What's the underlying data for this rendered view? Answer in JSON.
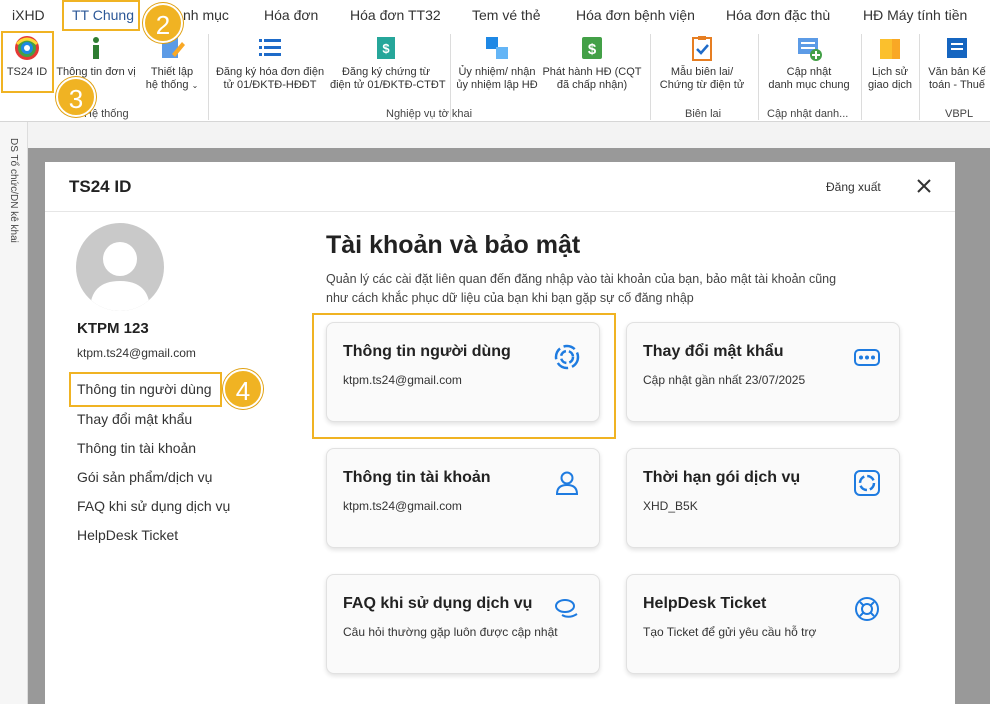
{
  "menu": {
    "tabs": [
      {
        "label": "iXHD"
      },
      {
        "label": "TT Chung"
      },
      {
        "label": "nh mục"
      },
      {
        "label": "Hóa đơn"
      },
      {
        "label": "Hóa đơn TT32"
      },
      {
        "label": "Tem vé thẻ"
      },
      {
        "label": "Hóa đơn bệnh viện"
      },
      {
        "label": "Hóa đơn đặc thù"
      },
      {
        "label": "HĐ Máy tính tiền"
      }
    ]
  },
  "ribbon": {
    "buttons": [
      {
        "label": "TS24 ID",
        "icon": "ts24-logo-icon"
      },
      {
        "label": "Thông tin đơn vị",
        "icon": "info-icon"
      },
      {
        "label": "Thiết lập\nhệ thống",
        "icon": "settings-pen-icon"
      },
      {
        "label": "Đăng ký hóa đơn điện\ntử 01/ĐKTĐ-HĐĐT",
        "icon": "list-icon"
      },
      {
        "label": "Đăng ký chứng từ\nđiện tử 01/ĐKTĐ-CTĐT",
        "icon": "document-dollar-icon"
      },
      {
        "label": "Ủy nhiệm/ nhận\nủy nhiệm lập HĐ",
        "icon": "copy-blocks-icon"
      },
      {
        "label": "Phát hành HĐ (CQT\nđã chấp nhận)",
        "icon": "dollar-green-icon"
      },
      {
        "label": "Mẫu biên lai/\nChứng từ điện tử",
        "icon": "clipboard-check-icon"
      },
      {
        "label": "Cập nhật\ndanh mục chung",
        "icon": "add-list-icon"
      },
      {
        "label": "Lịch sử\ngiao dịch",
        "icon": "folder-icon"
      },
      {
        "label": "Văn bản Kế\ntoán - Thuế",
        "icon": "blue-book-icon"
      }
    ],
    "groups": [
      {
        "label": "Hệ thống"
      },
      {
        "label": "Nghiệp vụ tờ khai"
      },
      {
        "label": "Biên lai"
      },
      {
        "label": "Cập nhật danh..."
      },
      {
        "label": "VBPL"
      }
    ]
  },
  "vertical_strip": {
    "label": "DS Tổ chức/DN kê khai"
  },
  "dialog": {
    "title": "TS24 ID",
    "logout_label": "Đăng xuất",
    "close_icon": "close-icon"
  },
  "user": {
    "name": "KTPM 123",
    "email": "ktpm.ts24@gmail.com"
  },
  "sidebar": {
    "items": [
      {
        "label": "Thông tin người dùng"
      },
      {
        "label": "Thay đổi mật khẩu"
      },
      {
        "label": "Thông tin tài khoản"
      },
      {
        "label": "Gói sản phẩm/dịch vụ"
      },
      {
        "label": "FAQ khi sử dụng dịch vụ"
      },
      {
        "label": "HelpDesk Ticket"
      }
    ]
  },
  "main": {
    "title": "Tài khoản và bảo mật",
    "description": "Quản lý các cài đặt liên quan đến đăng nhập vào tài khoản của bạn, bảo mật tài khoản cũng như cách khắc phục dữ liệu của bạn khi bạn gặp sự cố đăng nhập",
    "cards": [
      {
        "title": "Thông tin người dùng",
        "subtitle": "ktpm.ts24@gmail.com",
        "icon": "swirl-icon"
      },
      {
        "title": "Thay đổi mật khẩu",
        "subtitle": "Cập nhật gần nhất 23/07/2025",
        "icon": "password-dots-icon"
      },
      {
        "title": "Thông tin tài khoản",
        "subtitle": "ktpm.ts24@gmail.com",
        "icon": "user-icon"
      },
      {
        "title": "Thời hạn gói dịch vụ",
        "subtitle": "XHD_B5K",
        "icon": "swirl-badge-icon"
      },
      {
        "title": "FAQ khi sử dụng dịch vụ",
        "subtitle": "Câu hỏi thường gặp luôn được cập nhật",
        "icon": "chat-bubbles-icon"
      },
      {
        "title": "HelpDesk Ticket",
        "subtitle": "Tạo Ticket để gửi yêu cầu hỗ trợ",
        "icon": "lifebuoy-icon"
      }
    ]
  },
  "annotations": {
    "steps": [
      "2",
      "3",
      "4"
    ],
    "color": "#f0b323"
  },
  "colors": {
    "accent_blue": "#1e7be0",
    "highlight": "#f0b323"
  }
}
